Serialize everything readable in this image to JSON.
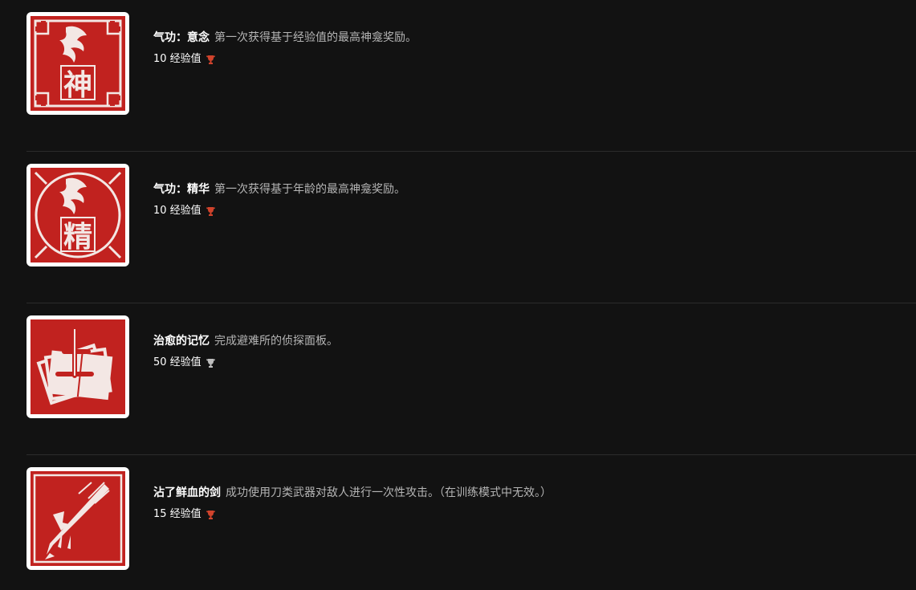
{
  "achievements": [
    {
      "name": "气功：意念",
      "description": "第一次获得基于经验值的最高神龛奖励。",
      "xp": "10 经验值",
      "trophy": "bronze-trophy-icon",
      "trophy_color": "#d0432c",
      "badge_glyph": "神",
      "badge_icon": "shrine-seal-icon"
    },
    {
      "name": "气功：精华",
      "description": "第一次获得基于年龄的最高神龛奖励。",
      "xp": "10 经验值",
      "trophy": "bronze-trophy-icon",
      "trophy_color": "#d0432c",
      "badge_glyph": "精",
      "badge_icon": "essence-seal-icon"
    },
    {
      "name": "治愈的记忆",
      "description": "完成避难所的侦探面板。",
      "xp": "50 经验值",
      "trophy": "silver-trophy-icon",
      "trophy_color": "#bdbdbd",
      "badge_glyph": "",
      "badge_icon": "detective-board-icon"
    },
    {
      "name": "沾了鲜血的剑",
      "description": "成功使用刀类武器对敌人进行一次性攻击。（在训练模式中无效。）",
      "xp": "15 经验值",
      "trophy": "bronze-trophy-icon",
      "trophy_color": "#d0432c",
      "badge_glyph": "",
      "badge_icon": "bloody-sword-icon"
    }
  ],
  "colors": {
    "background": "#121212",
    "badge_red": "#c1221f",
    "divider": "#2c2c2c"
  }
}
